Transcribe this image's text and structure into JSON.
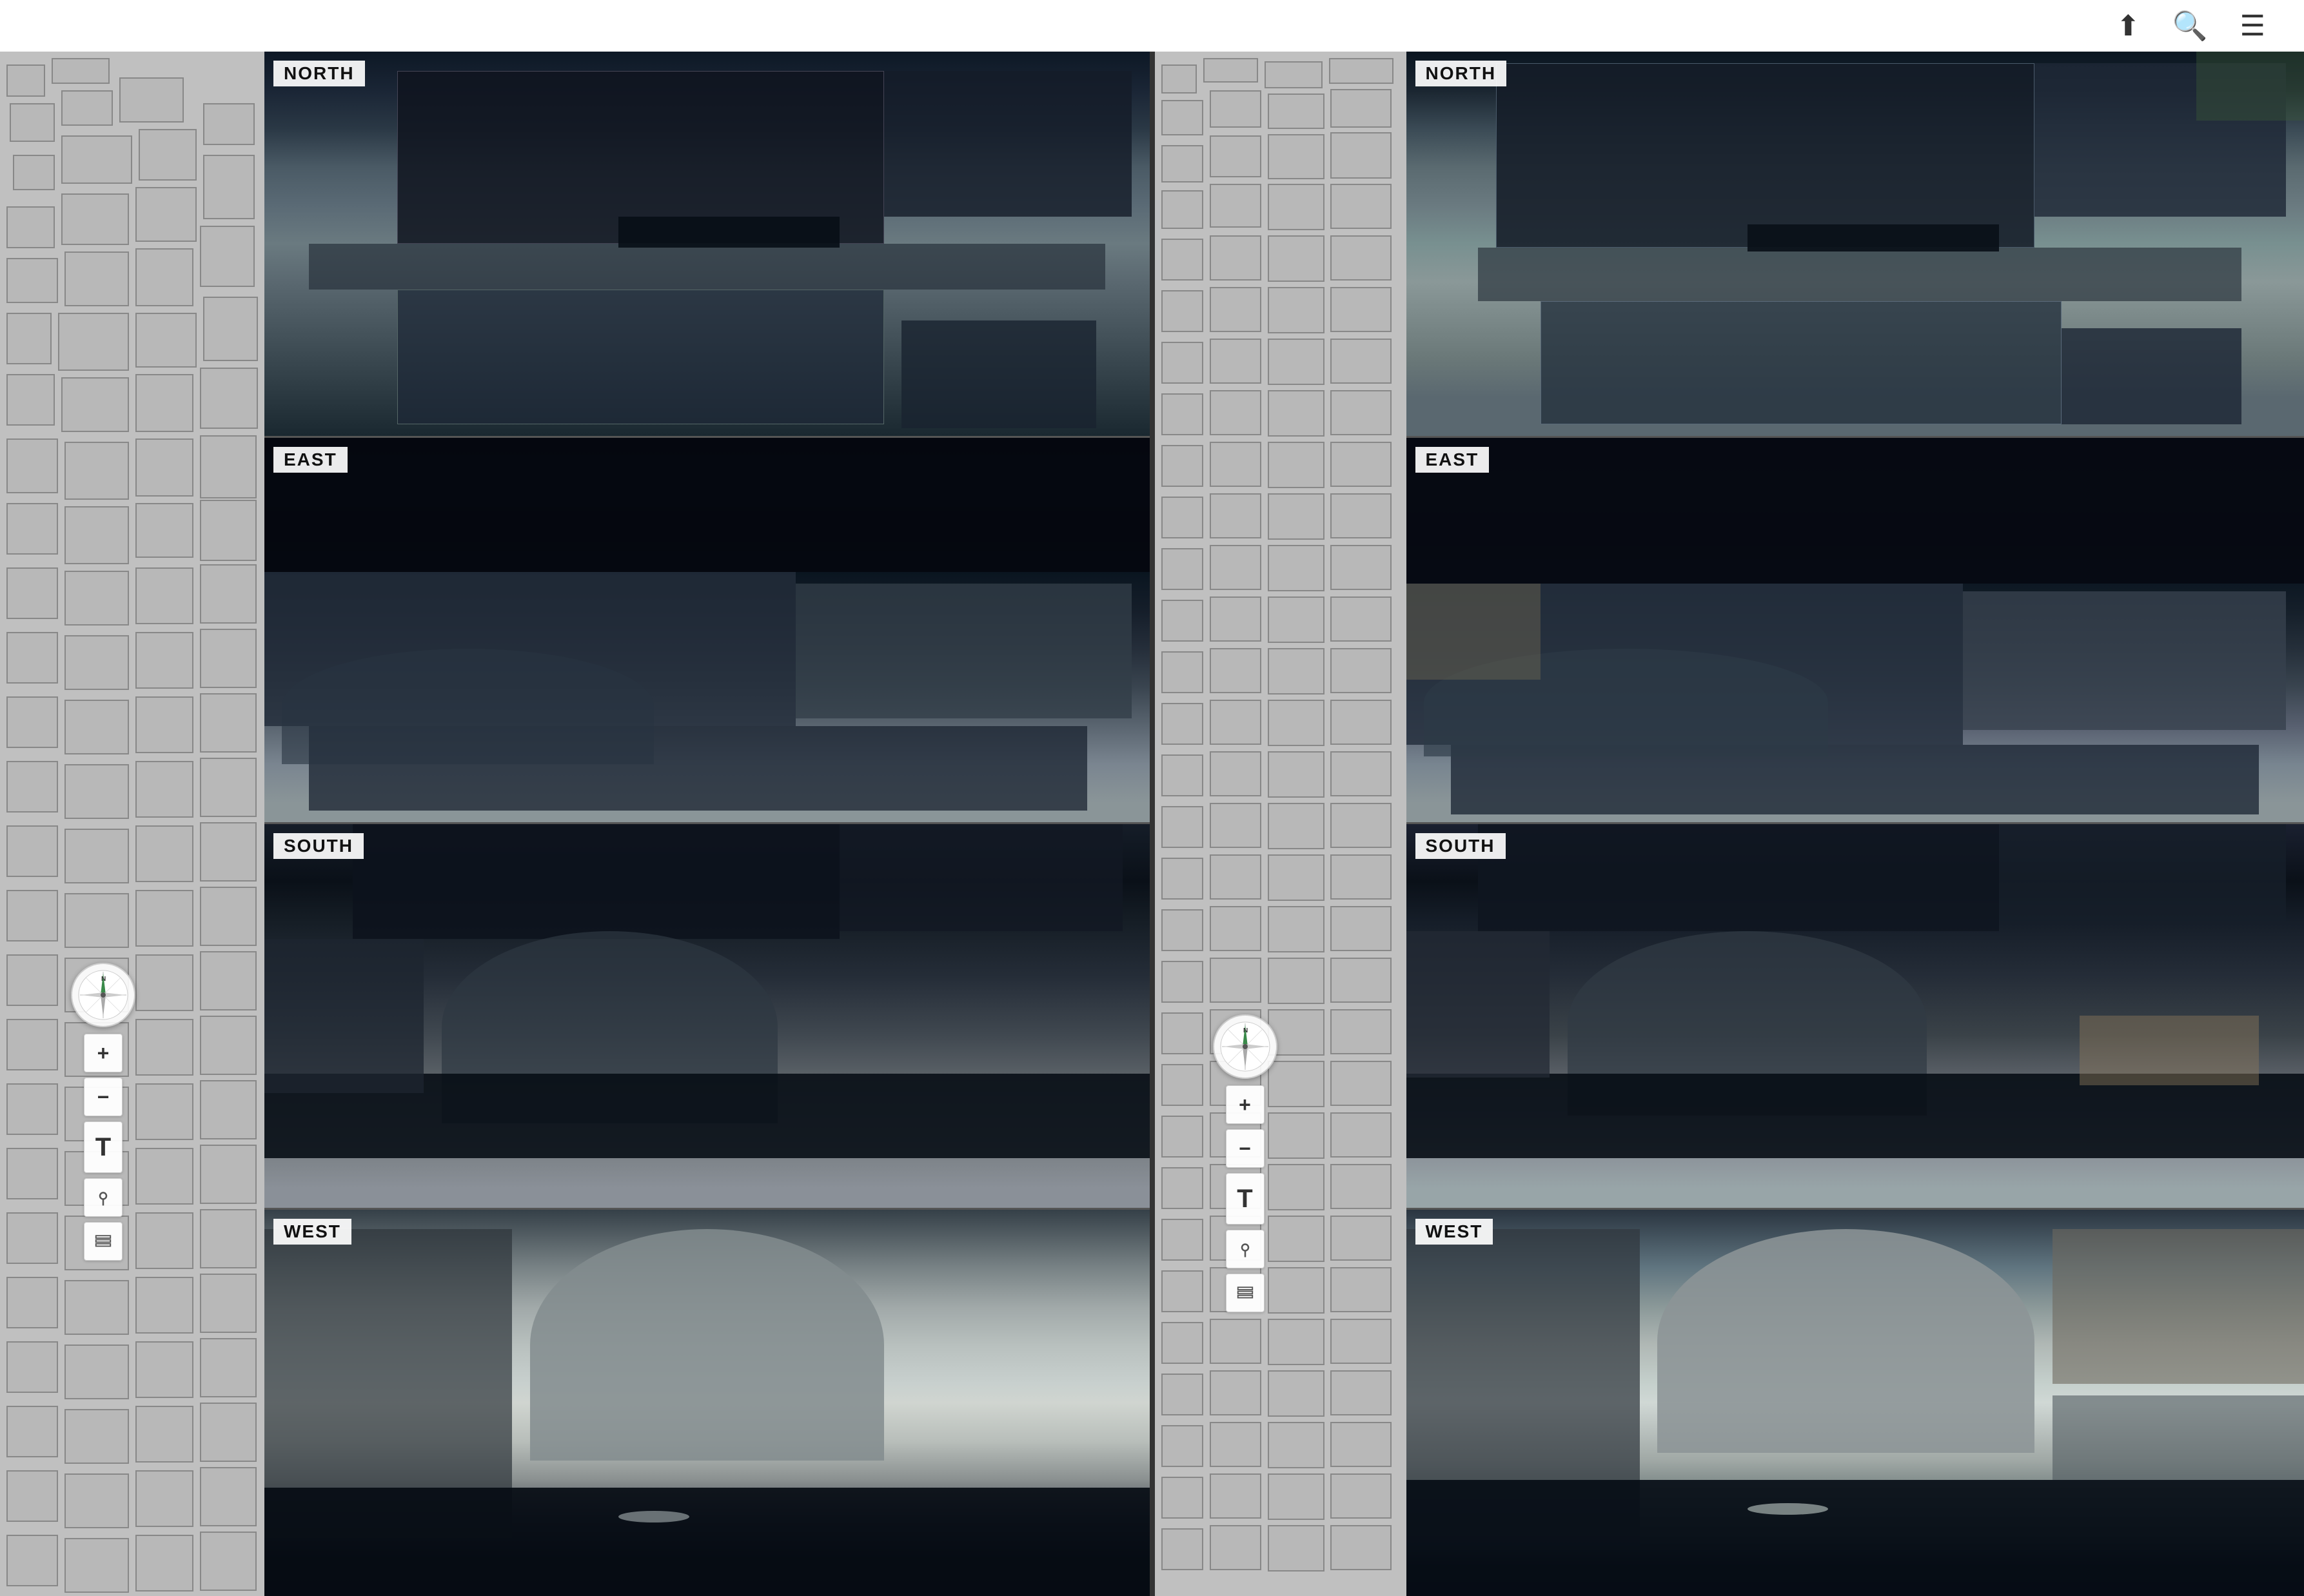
{
  "header": {
    "share_icon": "⬆",
    "search_icon": "🔍",
    "menu_icon": "☰"
  },
  "left_panel": {
    "directions": [
      {
        "label": "NORTH",
        "id": "north"
      },
      {
        "label": "EAST",
        "id": "east"
      },
      {
        "label": "SOUTH",
        "id": "south"
      },
      {
        "label": "WEST",
        "id": "west"
      }
    ],
    "compass": {
      "north_label": "N"
    },
    "controls": {
      "zoom_in": "+",
      "zoom_out": "−",
      "text_tool": "T",
      "pin_icon": "📍",
      "map_icon": "🗺"
    }
  },
  "right_panel": {
    "directions": [
      {
        "label": "NORTH",
        "id": "north"
      },
      {
        "label": "EAST",
        "id": "east"
      },
      {
        "label": "SOUTH",
        "id": "south"
      },
      {
        "label": "WEST",
        "id": "west"
      }
    ],
    "compass": {
      "north_label": "N"
    },
    "controls": {
      "zoom_in": "+",
      "zoom_out": "−",
      "text_tool": "T",
      "pin_icon": "📍",
      "map_icon": "🗺"
    }
  }
}
